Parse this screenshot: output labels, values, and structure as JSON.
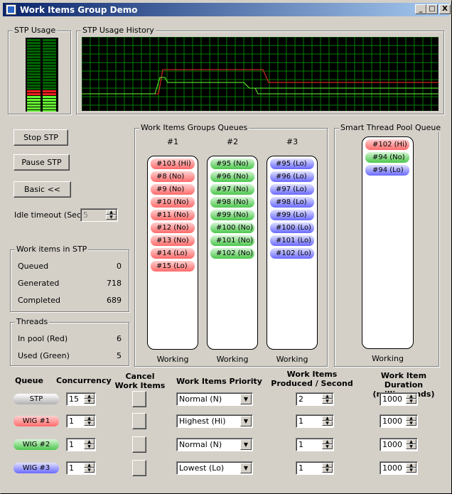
{
  "window": {
    "title": "Work Items Group Demo",
    "minimize": "_",
    "maximize": "□",
    "close": "X"
  },
  "stp_usage": {
    "title": "STP Usage"
  },
  "history": {
    "title": "STP Usage History"
  },
  "buttons": {
    "stop": "Stop STP",
    "pause": "Pause STP",
    "basic": "Basic <<"
  },
  "idle": {
    "label": "Idle timeout (Sec):",
    "value": "5"
  },
  "stats": {
    "title": "Work items in STP",
    "queued_label": "Queued",
    "queued": "0",
    "generated_label": "Generated",
    "generated": "718",
    "completed_label": "Completed",
    "completed": "689"
  },
  "threads": {
    "title": "Threads",
    "pool_label": "In pool (Red)",
    "pool": "6",
    "used_label": "Used (Green)",
    "used": "5"
  },
  "wig_queues": {
    "title": "Work Items Groups Queues",
    "cols": [
      {
        "header": "#1",
        "status": "Working",
        "items": [
          "#103 (Hi)",
          "#8 (No)",
          "#9 (No)",
          "#10 (No)",
          "#11 (No)",
          "#12 (No)",
          "#13 (No)",
          "#14 (Lo)",
          "#15 (Lo)"
        ]
      },
      {
        "header": "#2",
        "status": "Working",
        "items": [
          "#95 (No)",
          "#96 (No)",
          "#97 (No)",
          "#98 (No)",
          "#99 (No)",
          "#100 (No)",
          "#101 (No)",
          "#102 (No)"
        ]
      },
      {
        "header": "#3",
        "status": "Working",
        "items": [
          "#95 (Lo)",
          "#96 (Lo)",
          "#97 (Lo)",
          "#98 (Lo)",
          "#99 (Lo)",
          "#100 (Lo)",
          "#101 (Lo)",
          "#102 (Lo)"
        ]
      }
    ]
  },
  "stp_queue": {
    "title": "Smart Thread Pool Queue",
    "status": "Working",
    "items": [
      {
        "text": "#102 (Hi)",
        "color": "red"
      },
      {
        "text": "#94 (No)",
        "color": "green"
      },
      {
        "text": "#94 (Lo)",
        "color": "blue"
      }
    ]
  },
  "controls": {
    "headers": {
      "queue": "Queue",
      "concurrency": "Concurrency",
      "cancel": "Cancel\nWork Items",
      "priority": "Work Items Priority",
      "produced": "Work Items\nProduced / Second",
      "duration": "Work Item Duration\n(milliseconds)"
    },
    "rows": [
      {
        "queue": "STP",
        "color": "gray",
        "concurrency": "15",
        "priority": "Normal (N)",
        "produced": "2",
        "duration": "1000"
      },
      {
        "queue": "WIG #1",
        "color": "red",
        "concurrency": "1",
        "priority": "Highest (Hi)",
        "produced": "1",
        "duration": "1000"
      },
      {
        "queue": "WIG #2",
        "color": "green",
        "concurrency": "1",
        "priority": "Normal (N)",
        "produced": "1",
        "duration": "1000"
      },
      {
        "queue": "WIG #3",
        "color": "blue",
        "concurrency": "1",
        "priority": "Lowest (Lo)",
        "produced": "1",
        "duration": "1000"
      }
    ]
  }
}
